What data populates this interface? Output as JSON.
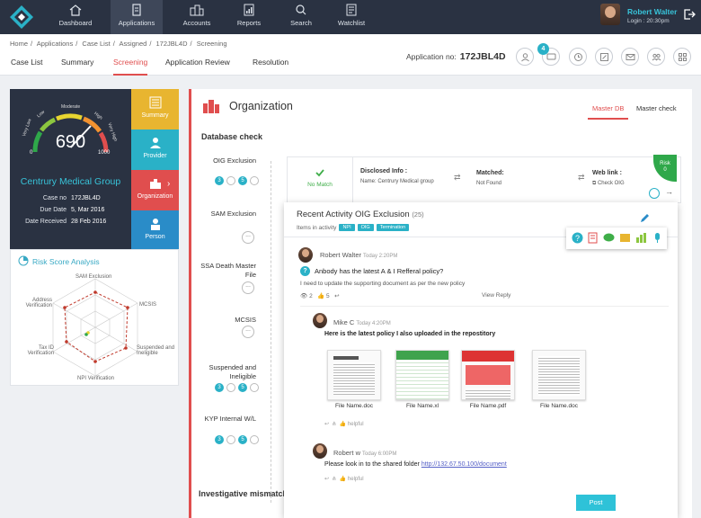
{
  "nav": {
    "items": [
      {
        "label": "Dashboard",
        "icon": "home-icon"
      },
      {
        "label": "Applications",
        "icon": "clipboard-icon"
      },
      {
        "label": "Accounts",
        "icon": "buildings-icon"
      },
      {
        "label": "Reports",
        "icon": "report-icon"
      },
      {
        "label": "Search",
        "icon": "search-icon"
      },
      {
        "label": "Watchlist",
        "icon": "watchlist-icon"
      }
    ],
    "active": "Applications",
    "user": {
      "name": "Robert Walter",
      "login": "Login : 20:30pm"
    }
  },
  "breadcrumb": [
    "Home",
    "/",
    "Applications",
    "/",
    "Case List",
    "/",
    "Assigned",
    "/",
    "172JBL4D",
    "/",
    "Screening"
  ],
  "tabs": [
    "Case List",
    "Summary",
    "Screening",
    "Application Review",
    "Resolution"
  ],
  "active_tab": "Screening",
  "application": {
    "label": "Application no:",
    "number": "172JBL4D",
    "badge": "4"
  },
  "scorecard": {
    "score": "690",
    "min": "0",
    "max": "1000",
    "gauge_labels": [
      "Very Low",
      "Low",
      "Moderate",
      "High",
      "Very High"
    ],
    "org_name": "Centrury Medical Group",
    "case_no_label": "Case no",
    "case_no": "172JBL4D",
    "due_label": "Due Date",
    "due": "5, Mar 2016",
    "received_label": "Date Received",
    "received": "28 Feb 2016"
  },
  "side_tabs": [
    "Summary",
    "Provider",
    "Organization",
    "Person"
  ],
  "risk": {
    "title": "Risk Score Analysis",
    "axes": [
      "SAM Exclusion",
      "MCSIS",
      "Suspended and Ineligible",
      "NPI Verification",
      "Tax ID Verification",
      "Address Verification"
    ]
  },
  "main": {
    "title": "Organization",
    "tabs": [
      "Master DB",
      "Master check"
    ],
    "section": "Database check",
    "checks": [
      {
        "label": "OIG Exclusion",
        "counts": [
          "3",
          "5"
        ]
      },
      {
        "label": "SAM Exclusion",
        "counts": []
      },
      {
        "label": "SSA Death Master File",
        "counts": []
      },
      {
        "label": "MCSIS",
        "counts": []
      },
      {
        "label": "Suspended and Ineligible",
        "counts": [
          "3",
          "5"
        ]
      },
      {
        "label": "KYP Internal W/L",
        "counts": [
          "3",
          "5"
        ]
      }
    ],
    "more": "...",
    "detail": {
      "status": "No Match",
      "disclosed_label": "Disclosed Info :",
      "disclosed_name": "Name: Centrury Medical group",
      "matched_label": "Matched:",
      "matched_value": "Not Found",
      "weblink_label": "Web link :",
      "weblink_value": "Check OIG",
      "risk_label": "Risk",
      "risk_value": "0"
    },
    "investigative": "Investigative mismatch"
  },
  "activity": {
    "title": "Recent Activity OIG Exclusion",
    "count": "(25)",
    "items_label": "Items in activity",
    "chips": [
      "NPI",
      "OIG",
      "Termination"
    ],
    "post1": {
      "author": "Robert Walter",
      "time": "Today 2:20PM",
      "question": "Anbody has the latest A & I Refferal policy?",
      "body": "I need to update the supporting document as per the new policy",
      "views": "2",
      "likes": "5",
      "view_reply": "View Reply"
    },
    "reply1": {
      "author": "Mike C",
      "time": "Today 4:20PM",
      "text": "Here is the latest policy I also uploaded in the repostitory",
      "files": [
        "File Name.doc",
        "File Name.xl",
        "File Name.pdf",
        "File Name.doc"
      ],
      "helpful": "helpful"
    },
    "reply2": {
      "author": "Robert w",
      "time": "Today 6:00PM",
      "text": "Please look in to the shared folder",
      "link": "http://132.67.50.100/document",
      "helpful": "helpful"
    },
    "post_button": "Post"
  },
  "colors": {
    "accent": "#e04e4e",
    "teal": "#2ab1c7",
    "nav": "#2a3242",
    "green": "#2fa84a",
    "yellow": "#e8b530",
    "red": "#e04e4e",
    "blue": "#2a8cc8"
  }
}
